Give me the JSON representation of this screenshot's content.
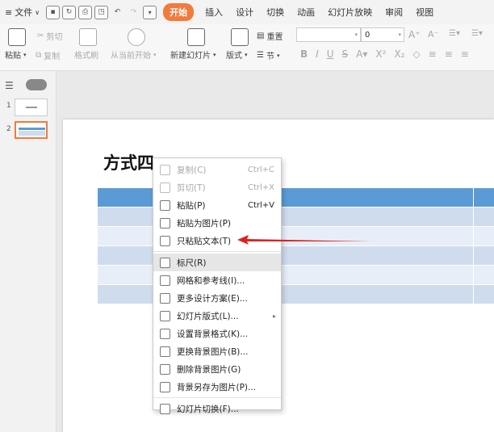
{
  "menubar": {
    "file_label": "文件",
    "tabs": [
      {
        "label": "开始",
        "active": true
      },
      {
        "label": "插入"
      },
      {
        "label": "设计"
      },
      {
        "label": "切换"
      },
      {
        "label": "动画"
      },
      {
        "label": "幻灯片放映"
      },
      {
        "label": "审阅"
      },
      {
        "label": "视图"
      }
    ]
  },
  "ribbon": {
    "paste": "粘贴",
    "cut": "剪切",
    "copy": "复制",
    "format_painter": "格式刷",
    "from_current": "从当前开始",
    "new_slide": "新建幻灯片",
    "layout": "版式",
    "reset": "重置",
    "section": "节",
    "font_size": "0"
  },
  "thumbnails": [
    {
      "number": "1"
    },
    {
      "number": "2",
      "selected": true
    }
  ],
  "slide": {
    "title": "方式四"
  },
  "context_menu": {
    "items": [
      {
        "label": "复制(C)",
        "shortcut": "Ctrl+C",
        "disabled": true,
        "icon": "copy-icon"
      },
      {
        "label": "剪切(T)",
        "shortcut": "Ctrl+X",
        "disabled": true,
        "icon": "cut-icon"
      },
      {
        "label": "粘贴(P)",
        "shortcut": "Ctrl+V",
        "icon": "paste-icon"
      },
      {
        "label": "粘贴为图片(P)",
        "icon": "paste-as-image-icon"
      },
      {
        "label": "只粘贴文本(T)",
        "icon": "paste-text-only-icon"
      },
      {
        "label": "标尺(R)",
        "highlighted": true,
        "icon": "ruler-icon"
      },
      {
        "label": "网格和参考线(I)...",
        "icon": "grid-icon"
      },
      {
        "label": "更多设计方案(E)...",
        "icon": "design-icon"
      },
      {
        "label": "幻灯片版式(L)...",
        "submenu": true,
        "icon": "layout-icon"
      },
      {
        "label": "设置背景格式(K)...",
        "icon": "background-format-icon"
      },
      {
        "label": "更换背景图片(B)...",
        "icon": "change-background-icon"
      },
      {
        "label": "删除背景图片(G)",
        "icon": "delete-background-icon"
      },
      {
        "label": "背景另存为图片(P)...",
        "icon": "save-background-icon"
      },
      {
        "label": "幻灯片切换(F)...",
        "icon": "transition-icon"
      }
    ]
  },
  "colors": {
    "accent": "#f27a3c",
    "table_header": "#5b9bd5",
    "arrow": "#e02020"
  }
}
